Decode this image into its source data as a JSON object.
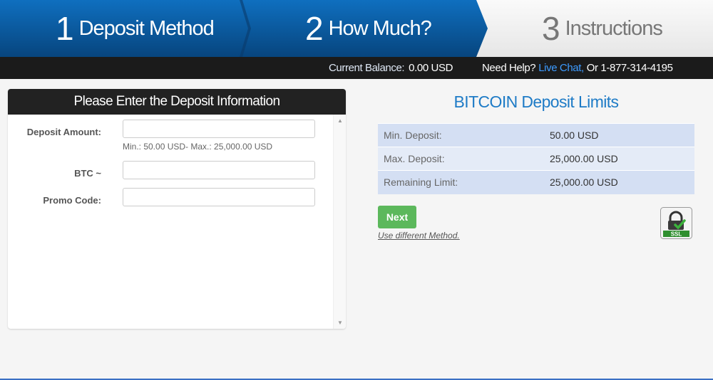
{
  "steps": [
    {
      "number": "1",
      "label": "Deposit Method"
    },
    {
      "number": "2",
      "label": "How Much?"
    },
    {
      "number": "3",
      "label": "Instructions"
    }
  ],
  "infobar": {
    "balance_label": "Current Balance:",
    "balance_value": "0.00 USD",
    "help_label": "Need Help?",
    "live_chat": "Live Chat,",
    "phone": "Or 1-877-314-4195"
  },
  "form": {
    "title": "Please Enter the Deposit Information",
    "deposit_amount_label": "Deposit Amount:",
    "deposit_amount_value": "",
    "deposit_hint": "Min.: 50.00 USD- Max.: 25,000.00 USD",
    "btc_label": "BTC ~",
    "btc_value": "",
    "promo_label": "Promo Code:",
    "promo_value": ""
  },
  "limits": {
    "title": "BITCOIN Deposit Limits",
    "rows": [
      {
        "label": "Min. Deposit:",
        "value": "50.00 USD"
      },
      {
        "label": "Max. Deposit:",
        "value": "25,000.00 USD"
      },
      {
        "label": "Remaining Limit:",
        "value": "25,000.00 USD"
      }
    ]
  },
  "actions": {
    "next_label": "Next",
    "different_method": "Use different Method."
  },
  "ssl_badge": {
    "text": "SSL",
    "icon": "ssl-lock-icon"
  },
  "colors": {
    "step_blue": "#0b5fa5",
    "link_blue": "#3d9bff",
    "title_blue": "#1e7bc6",
    "next_green": "#5cb85c"
  }
}
